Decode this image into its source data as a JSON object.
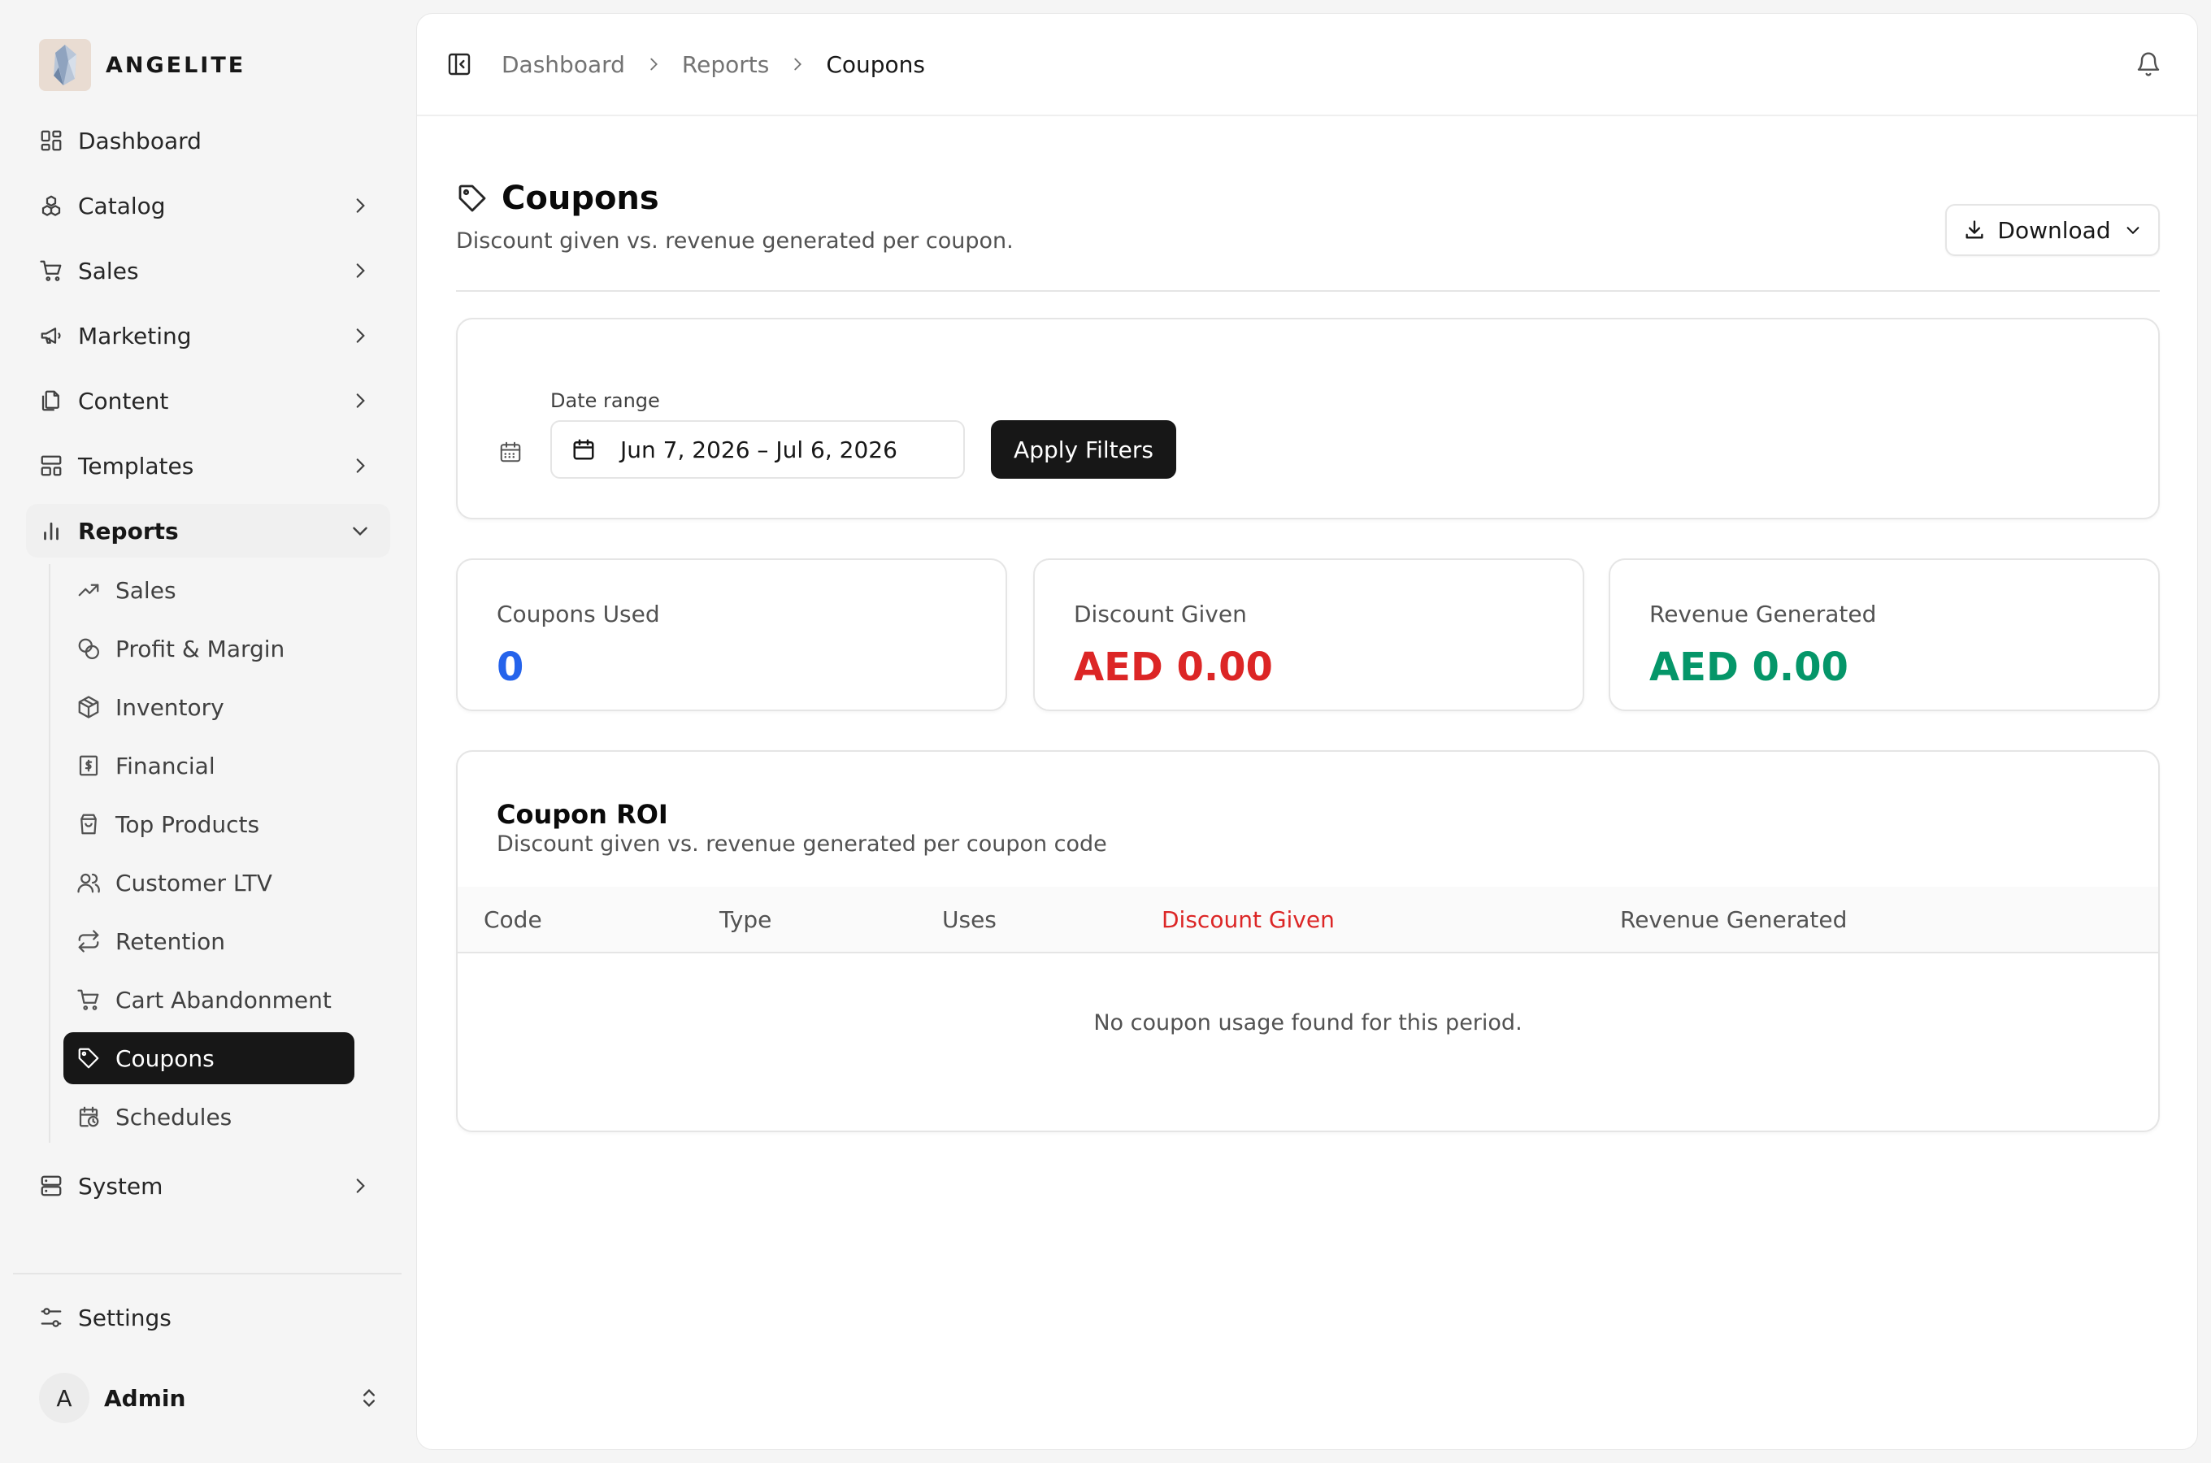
{
  "brand": {
    "name": "ANGELITE",
    "logo_icon": "crystal-logo"
  },
  "sidebar": {
    "items": [
      {
        "label": "Dashboard",
        "icon": "dashboard-icon"
      },
      {
        "label": "Catalog",
        "icon": "catalog-icon"
      },
      {
        "label": "Sales",
        "icon": "cart-icon"
      },
      {
        "label": "Marketing",
        "icon": "megaphone-icon"
      },
      {
        "label": "Content",
        "icon": "files-icon"
      },
      {
        "label": "Templates",
        "icon": "templates-icon"
      },
      {
        "label": "Reports",
        "icon": "bar-chart-icon",
        "expanded": true
      }
    ],
    "report_items": [
      {
        "label": "Sales",
        "icon": "trending-up-icon"
      },
      {
        "label": "Profit & Margin",
        "icon": "coins-icon"
      },
      {
        "label": "Inventory",
        "icon": "package-icon"
      },
      {
        "label": "Financial",
        "icon": "receipt-icon"
      },
      {
        "label": "Top Products",
        "icon": "shopping-bag-icon"
      },
      {
        "label": "Customer LTV",
        "icon": "users-icon"
      },
      {
        "label": "Retention",
        "icon": "repeat-icon"
      },
      {
        "label": "Cart Abandonment",
        "icon": "cart-icon"
      },
      {
        "label": "Coupons",
        "icon": "tag-icon",
        "active": true
      },
      {
        "label": "Schedules",
        "icon": "calendar-clock-icon"
      }
    ],
    "system": {
      "label": "System",
      "icon": "server-icon"
    },
    "settings": {
      "label": "Settings",
      "icon": "sliders-icon"
    },
    "user": {
      "initial": "A",
      "name": "Admin"
    }
  },
  "breadcrumb": [
    "Dashboard",
    "Reports",
    "Coupons"
  ],
  "page": {
    "title": "Coupons",
    "subtitle": "Discount given vs. revenue generated per coupon.",
    "download_label": "Download"
  },
  "filters": {
    "date_label": "Date range",
    "date_value": "Jun 7, 2026 – Jul 6, 2026",
    "apply_label": "Apply Filters"
  },
  "stats": [
    {
      "label": "Coupons Used",
      "value": "0",
      "color": "#2563eb"
    },
    {
      "label": "Discount Given",
      "value": "AED 0.00",
      "color": "#dc2626"
    },
    {
      "label": "Revenue Generated",
      "value": "AED 0.00",
      "color": "#059669"
    }
  ],
  "roi_table": {
    "title": "Coupon ROI",
    "subtitle": "Discount given vs. revenue generated per coupon code",
    "columns": [
      "Code",
      "Type",
      "Uses",
      "Discount Given",
      "Revenue Generated"
    ],
    "highlight_column_color": "#dc2626",
    "empty_message": "No coupon usage found for this period."
  }
}
